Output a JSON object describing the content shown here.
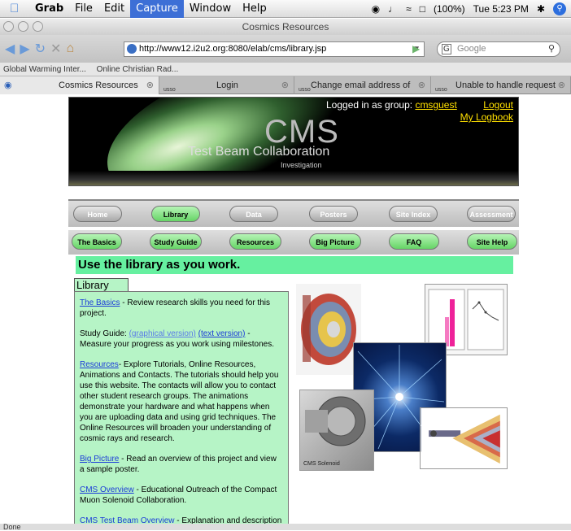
{
  "menubar": {
    "app": "Grab",
    "items": [
      "File",
      "Edit",
      "Capture",
      "Window",
      "Help"
    ],
    "active": "Capture",
    "battery": "(100%)",
    "clock": "Tue 5:23 PM"
  },
  "window": {
    "title": "Cosmics Resources"
  },
  "toolbar": {
    "url": "http://www12.i2u2.org:8080/elab/cms/library.jsp",
    "search_placeholder": "Google"
  },
  "bookmarks": [
    "Global Warming Inter...",
    "Online Christian Rad..."
  ],
  "tabs": [
    {
      "label": "Cosmics Resources",
      "favicon": "globe-icon"
    },
    {
      "label": "Login",
      "favicon": "usso"
    },
    {
      "label": "Change email address of account",
      "favicon": "usso"
    },
    {
      "label": "Unable to handle request",
      "favicon": "usso"
    }
  ],
  "banner": {
    "title": "CMS",
    "subtitle": "Test Beam Collaboration",
    "investigation": "Investigation",
    "login_text": "Logged in as group:",
    "group": "cmsguest",
    "logout": "Logout",
    "logbook": "My Logbook"
  },
  "nav_top": [
    "Home",
    "Library",
    "Data",
    "Posters",
    "Site Index",
    "Assessment"
  ],
  "nav_bottom": [
    "The Basics",
    "Study Guide",
    "Resources",
    "Big Picture",
    "FAQ",
    "Site Help"
  ],
  "page": {
    "headline": "Use the library as you work.",
    "library_tab": "Library"
  },
  "library": {
    "basics_link": "The Basics",
    "basics_text": " - Review research skills you need for this project.",
    "study_text": "Study Guide: ",
    "study_link1": "(graphical version)",
    "study_link2": "(text version)",
    "study_text2": " - Measure your progress as you work using milestones.",
    "res_link": "Resources",
    "res_text": "- Explore Tutorials, Online Resources, Animations and Contacts. The tutorials should help you use this website. The contacts will allow you to contact other student research groups. The animations demonstrate your hardware and what happens when you are uploading data and using grid techniques. The Online Resources will broaden your understanding of cosmic rays and research.",
    "big_link": "Big Picture",
    "big_text": " - Read an overview of this project and view a sample poster.",
    "cms_link": "CMS Overview",
    "cms_text": " - Educational Outreach of the Compact Muon Solenoid Collaboration.",
    "tb_link": "CMS Test Beam Overview",
    "tb_text": " - Explanation  and description of Compact Muon Solenoid Collaboration's Test Beam effort."
  },
  "pics": {
    "solenoid_label": "CMS Solenoid"
  },
  "status": "Done",
  "colors": {
    "accent": "#3d6fd6",
    "headline_bg": "#66f0a0",
    "library_bg": "#b6f4c6",
    "link": "#1a3bd8",
    "banner_link": "#ffe000"
  }
}
